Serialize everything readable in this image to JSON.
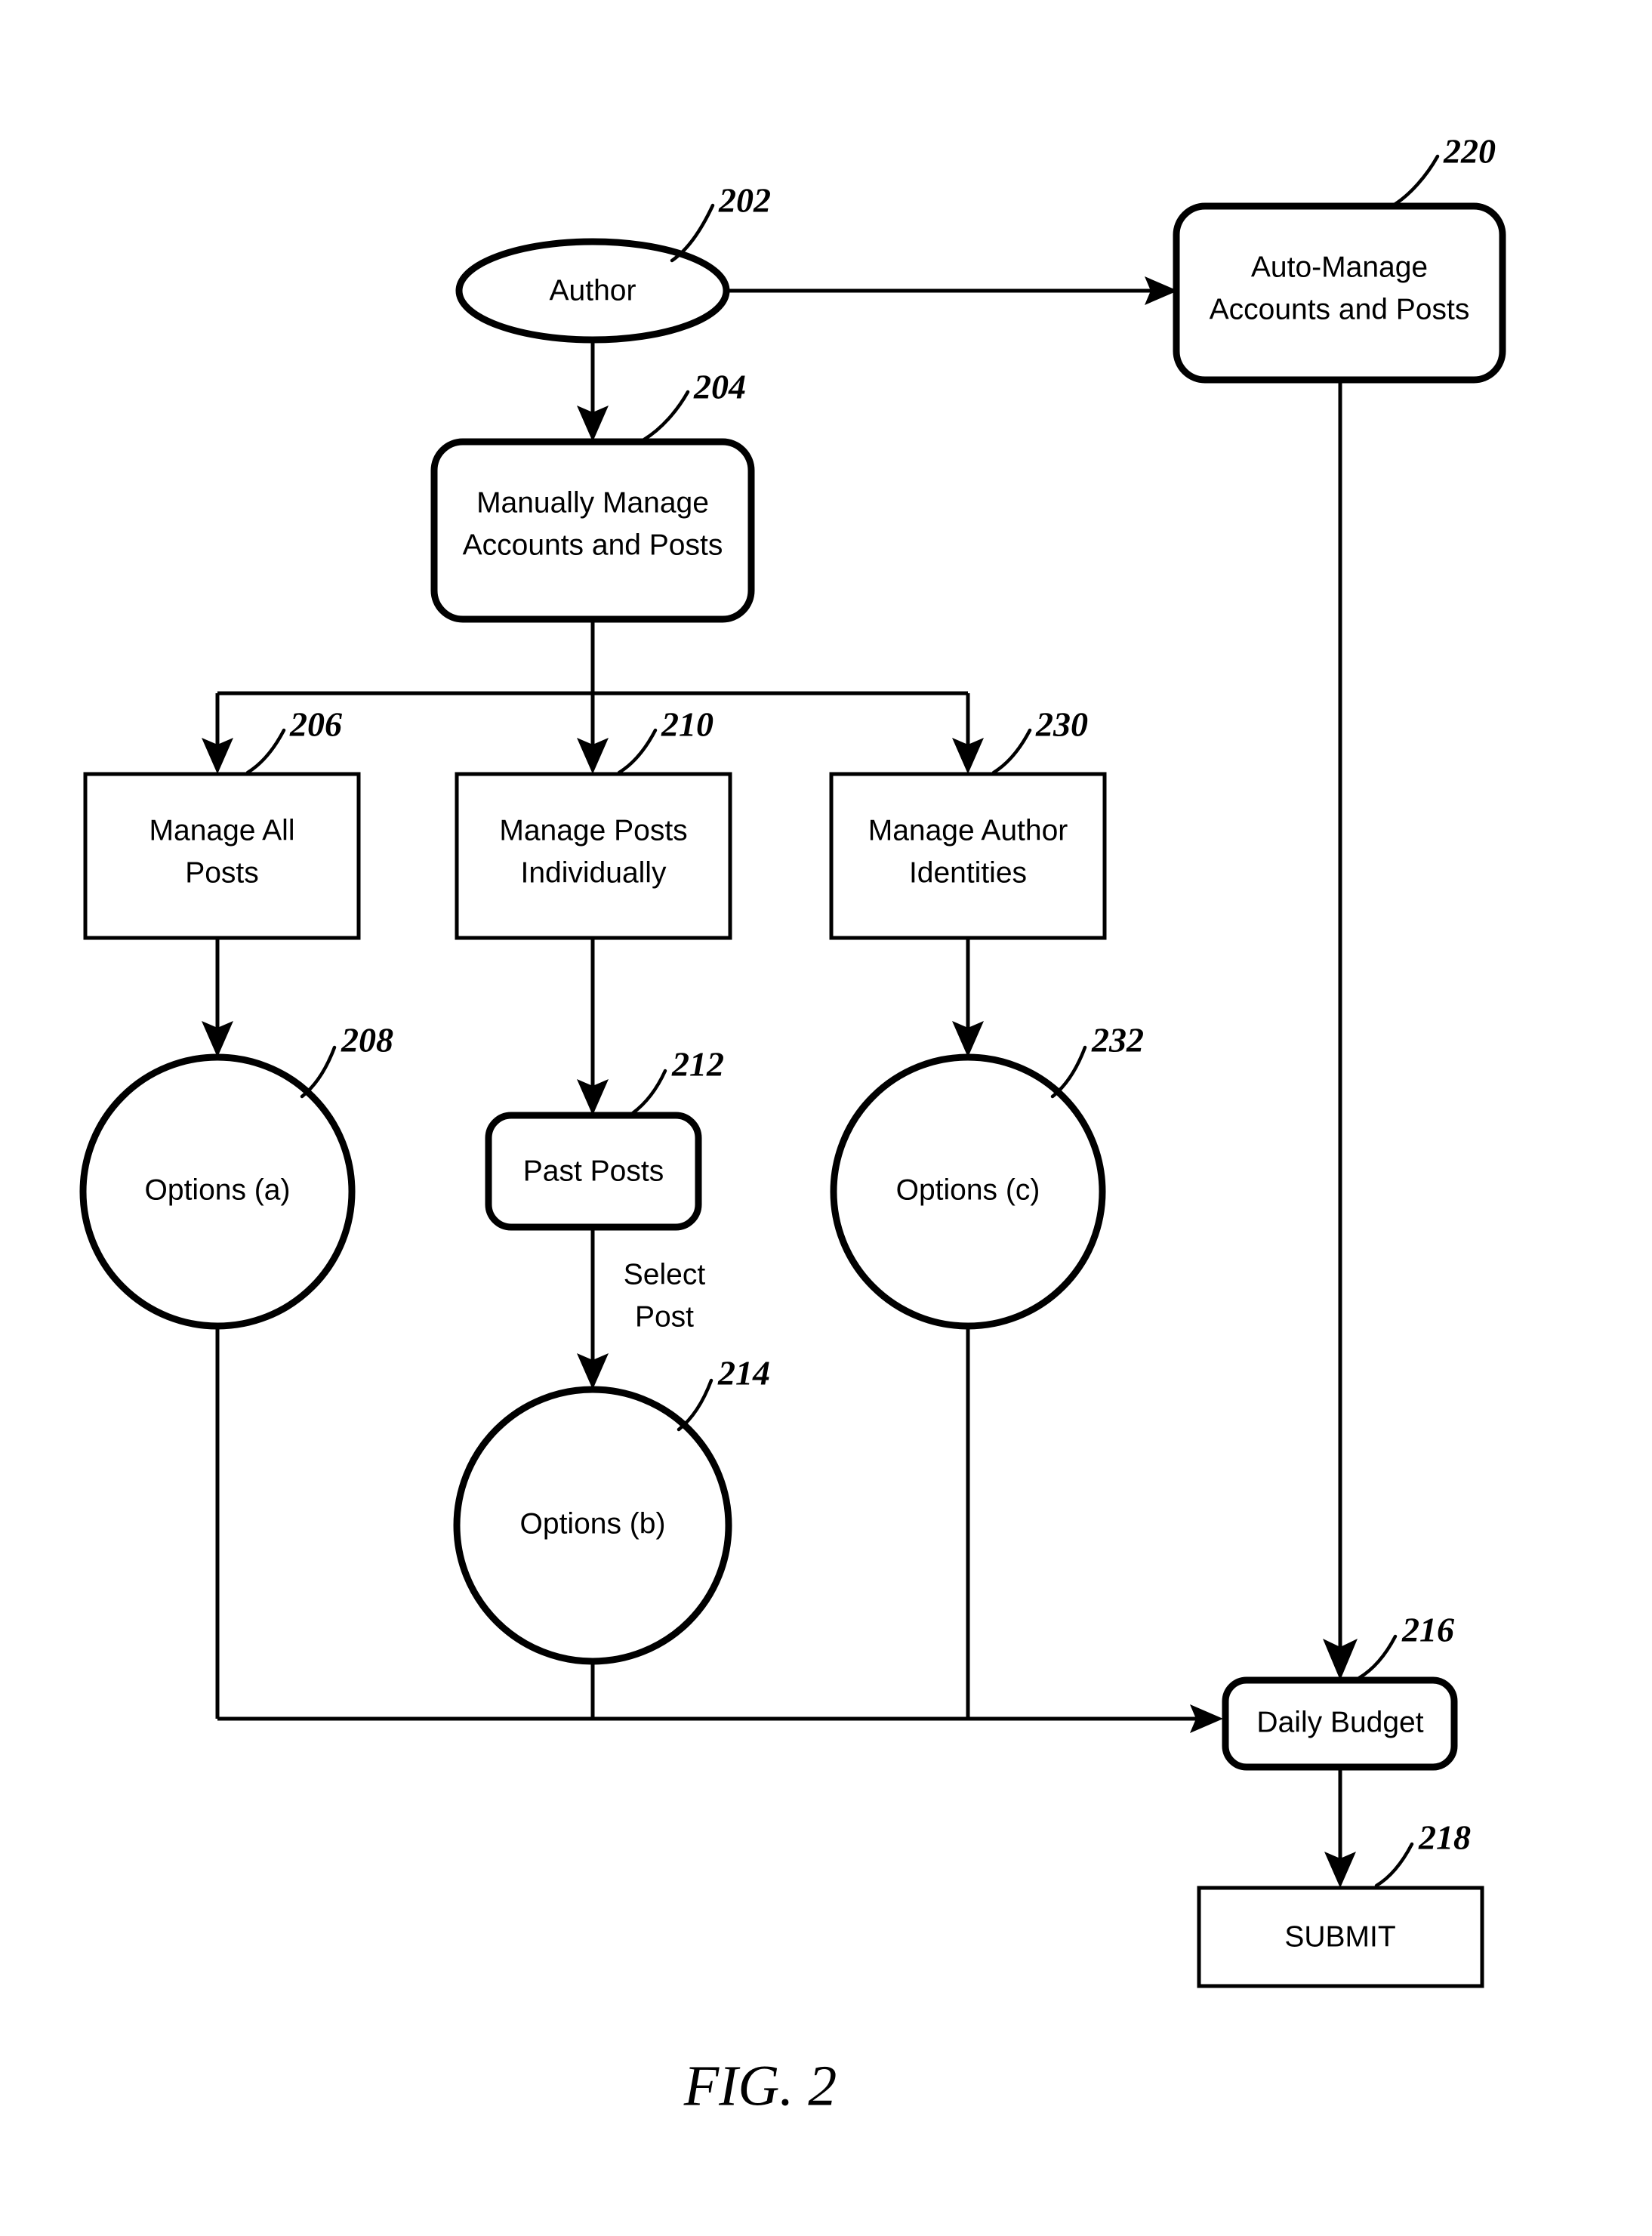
{
  "figure": {
    "caption": "FIG. 2",
    "background_color": "#ffffff",
    "line_color": "#000000"
  },
  "nodes": {
    "author": {
      "label": "Author",
      "ref": "202",
      "shape": "ellipse"
    },
    "auto_manage": {
      "label_line1": "Auto-Manage",
      "label_line2": "Accounts and Posts",
      "ref": "220",
      "shape": "rounded-rect"
    },
    "manually_manage": {
      "label_line1": "Manually Manage",
      "label_line2": "Accounts and Posts",
      "ref": "204",
      "shape": "rounded-rect"
    },
    "manage_all_posts": {
      "label_line1": "Manage All",
      "label_line2": "Posts",
      "ref": "206",
      "shape": "rect"
    },
    "manage_posts_individually": {
      "label_line1": "Manage Posts",
      "label_line2": "Individually",
      "ref": "210",
      "shape": "rect"
    },
    "manage_author_identities": {
      "label_line1": "Manage Author",
      "label_line2": "Identities",
      "ref": "230",
      "shape": "rect"
    },
    "options_a": {
      "label": "Options (a)",
      "ref": "208",
      "shape": "circle"
    },
    "past_posts": {
      "label": "Past Posts",
      "ref": "212",
      "shape": "rounded-rect"
    },
    "options_c": {
      "label": "Options (c)",
      "ref": "232",
      "shape": "circle"
    },
    "options_b": {
      "label": "Options (b)",
      "ref": "214",
      "shape": "circle"
    },
    "daily_budget": {
      "label": "Daily Budget",
      "ref": "216",
      "shape": "rounded-rect"
    },
    "submit": {
      "label": "SUBMIT",
      "ref": "218",
      "shape": "rect"
    }
  },
  "edge_labels": {
    "select_post_line1": "Select",
    "select_post_line2": "Post"
  },
  "chart_data": {
    "type": "table",
    "title": "FIG. 2",
    "nodes": [
      {
        "ref": "202",
        "text": "Author",
        "shape": "ellipse"
      },
      {
        "ref": "204",
        "text": "Manually Manage Accounts and Posts",
        "shape": "rounded-rect"
      },
      {
        "ref": "206",
        "text": "Manage All Posts",
        "shape": "rect"
      },
      {
        "ref": "208",
        "text": "Options (a)",
        "shape": "circle"
      },
      {
        "ref": "210",
        "text": "Manage Posts Individually",
        "shape": "rect"
      },
      {
        "ref": "212",
        "text": "Past Posts",
        "shape": "rounded-rect"
      },
      {
        "ref": "214",
        "text": "Options (b)",
        "shape": "circle"
      },
      {
        "ref": "216",
        "text": "Daily Budget",
        "shape": "rounded-rect"
      },
      {
        "ref": "218",
        "text": "SUBMIT",
        "shape": "rect"
      },
      {
        "ref": "220",
        "text": "Auto-Manage Accounts and Posts",
        "shape": "rounded-rect"
      },
      {
        "ref": "230",
        "text": "Manage Author Identities",
        "shape": "rect"
      },
      {
        "ref": "232",
        "text": "Options (c)",
        "shape": "circle"
      }
    ],
    "edges": [
      {
        "from": "202",
        "to": "220",
        "label": ""
      },
      {
        "from": "202",
        "to": "204",
        "label": ""
      },
      {
        "from": "204",
        "to": "206",
        "label": ""
      },
      {
        "from": "204",
        "to": "210",
        "label": ""
      },
      {
        "from": "204",
        "to": "230",
        "label": ""
      },
      {
        "from": "206",
        "to": "208",
        "label": ""
      },
      {
        "from": "210",
        "to": "212",
        "label": ""
      },
      {
        "from": "212",
        "to": "214",
        "label": "Select Post"
      },
      {
        "from": "230",
        "to": "232",
        "label": ""
      },
      {
        "from": "208",
        "to": "216",
        "label": ""
      },
      {
        "from": "214",
        "to": "216",
        "label": ""
      },
      {
        "from": "232",
        "to": "216",
        "label": ""
      },
      {
        "from": "220",
        "to": "216",
        "label": ""
      },
      {
        "from": "216",
        "to": "218",
        "label": ""
      }
    ]
  }
}
